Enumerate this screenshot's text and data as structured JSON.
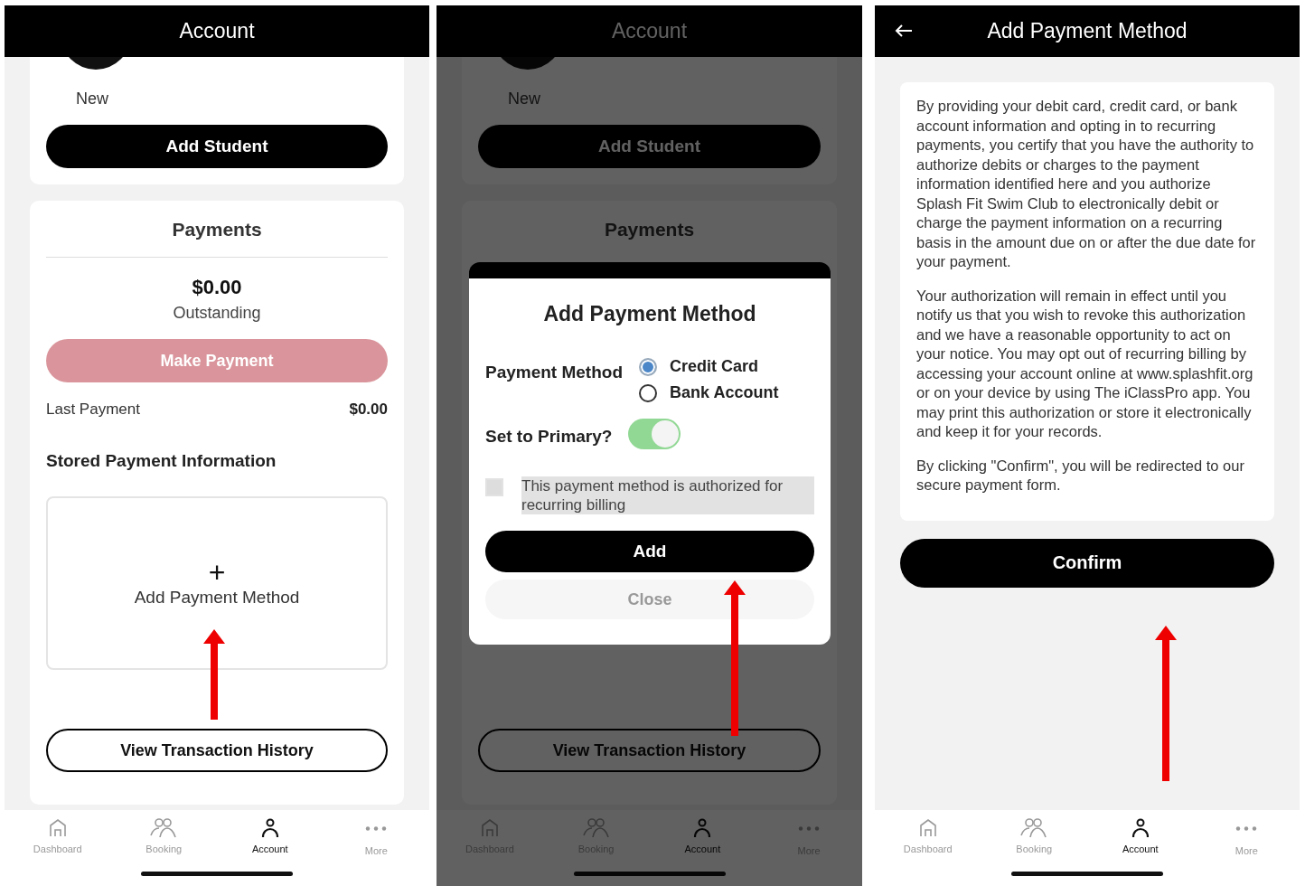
{
  "screens": [
    {
      "kind": "account",
      "header": {
        "title": "Account",
        "back": false
      },
      "student": {
        "name": "New",
        "button": "Add Student"
      },
      "payments": {
        "title": "Payments",
        "amount": "$0.00",
        "amount_label": "Outstanding",
        "pay_button": {
          "label": "Make Payment",
          "disabled": true
        },
        "last_payment": {
          "label": "Last Payment",
          "value": "$0.00"
        },
        "stored_title": "Stored Payment Information",
        "add_method": {
          "icon": "+",
          "label": "Add Payment Method"
        },
        "history_button": "View Transaction History"
      },
      "nav": [
        {
          "kind": "home",
          "label": "Dashboard",
          "selected": false
        },
        {
          "kind": "people",
          "label": "Booking",
          "selected": false
        },
        {
          "kind": "person",
          "label": "Account",
          "selected": true
        },
        {
          "kind": "dots",
          "label": "More",
          "selected": false
        }
      ]
    },
    {
      "kind": "account",
      "header": {
        "title": "Account",
        "back": false
      },
      "student": {
        "name": "New",
        "button": "Add Student"
      },
      "payments": {
        "title": "Payments",
        "history_button": "View Transaction History"
      },
      "modal": {
        "title": "Add Payment Method",
        "method_label": "Payment Method",
        "options": [
          {
            "label": "Credit Card",
            "selected": true
          },
          {
            "label": "Bank Account",
            "selected": false
          }
        ],
        "primary_label": "Set to Primary?",
        "primary_on": true,
        "authorized": {
          "label": "This payment method is authorized for recurring billing",
          "checked": false
        },
        "add_button": "Add",
        "close_button": "Close"
      },
      "nav": [
        {
          "kind": "home",
          "label": "Dashboard",
          "selected": false
        },
        {
          "kind": "people",
          "label": "Booking",
          "selected": false
        },
        {
          "kind": "person",
          "label": "Account",
          "selected": true
        },
        {
          "kind": "dots",
          "label": "More",
          "selected": false
        }
      ]
    },
    {
      "kind": "authorization",
      "header": {
        "title": "Add Payment Method",
        "back": true
      },
      "paragraphs": [
        "By providing your debit card, credit card, or bank account information and opting in to recurring payments, you certify that you have the authority to authorize debits or charges to the payment information identified here and you authorize Splash Fit Swim Club to electronically debit or charge the payment information on a recurring basis in the amount due on or after the due date for your payment.",
        "Your authorization will remain in effect until you notify us that you wish to revoke this authorization and we have a reasonable opportunity to act on your notice. You may opt out of recurring billing by accessing your account online at www.splashfit.org or on your device by using The iClassPro app. You may print this authorization or store it electronically and keep it for your records.",
        "By clicking \"Confirm\", you will be redirected to our secure payment form."
      ],
      "confirm_button": "Confirm",
      "nav": [
        {
          "kind": "home",
          "label": "Dashboard",
          "selected": false
        },
        {
          "kind": "people",
          "label": "Booking",
          "selected": false
        },
        {
          "kind": "person",
          "label": "Account",
          "selected": true
        },
        {
          "kind": "dots",
          "label": "More",
          "selected": false
        }
      ]
    }
  ]
}
